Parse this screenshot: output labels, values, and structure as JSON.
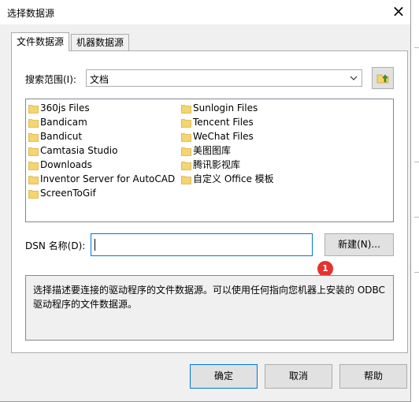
{
  "window": {
    "title": "选择数据源"
  },
  "tabs": [
    {
      "label": "文件数据源",
      "active": true
    },
    {
      "label": "机器数据源",
      "active": false
    }
  ],
  "search": {
    "label": "搜索范围(I):",
    "value": "文档"
  },
  "files": {
    "left": [
      "360js Files",
      "Bandicam",
      "Bandicut",
      "Camtasia Studio",
      "Downloads",
      "Inventor Server for AutoCAD",
      "ScreenToGif"
    ],
    "right": [
      "Sunlogin Files",
      "Tencent Files",
      "WeChat Files",
      "美图图库",
      "腾讯影视库",
      "自定义 Office 模板"
    ]
  },
  "dsn": {
    "label": "DSN 名称(D):",
    "value": ""
  },
  "buttons": {
    "new": "新建(N)...",
    "ok": "确定",
    "cancel": "取消",
    "help": "帮助"
  },
  "annotation_badge": "1",
  "description": "选择描述要连接的驱动程序的文件数据源。可以使用任何指向您机器上安装的 ODBC 驱动程序的文件数据源。",
  "colors": {
    "accent": "#0078d7",
    "badge": "#e5322e",
    "folder": "#f4d56e"
  }
}
